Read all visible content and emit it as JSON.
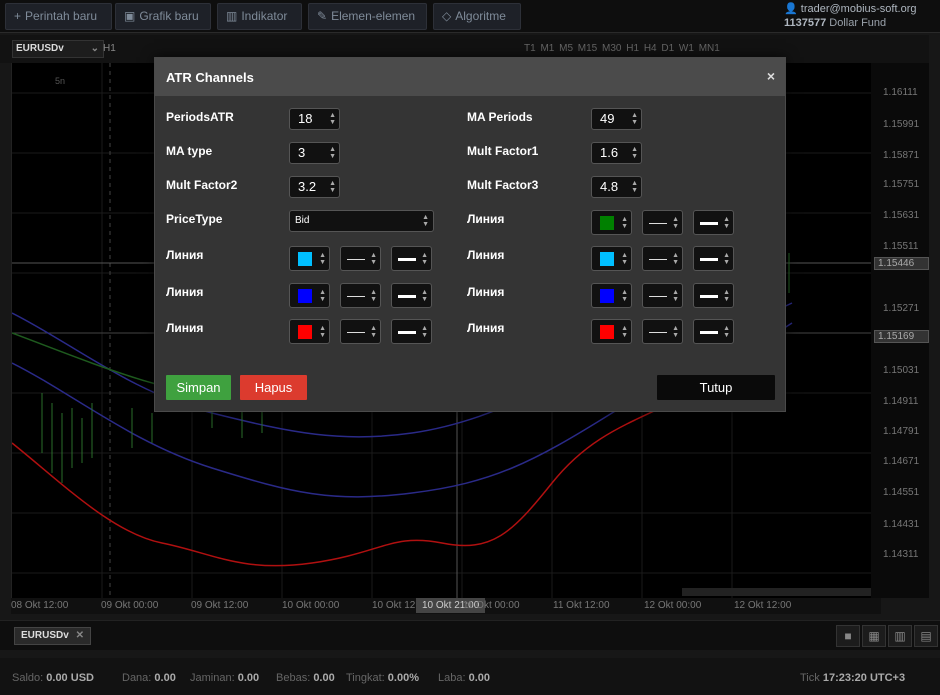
{
  "toolbar": {
    "new_order": "Perintah baru",
    "new_chart": "Grafik baru",
    "indicator": "Indikator",
    "elements": "Elemen-elemen",
    "algorithm": "Algoritme"
  },
  "account": {
    "user": "trader@mobius-soft.org",
    "id": "1137577",
    "fund": "Dollar Fund"
  },
  "chart": {
    "symbol": "EURUSDv",
    "timeframe": "H1",
    "timeframes": "T1 M1 M5 M15 M30 H1 H4 D1 W1 MN1",
    "corner_label": "5n",
    "prices": [
      "1.16111",
      "1.15991",
      "1.15871",
      "1.15751",
      "1.15631",
      "1.15511",
      "1.15446",
      "1.15271",
      "1.15169",
      "1.15031",
      "1.14911",
      "1.14791",
      "1.14671",
      "1.14551",
      "1.14431",
      "1.14311"
    ],
    "times": [
      "08 Okt 12:00",
      "09 Okt 00:00",
      "09 Okt 12:00",
      "10 Okt 00:00",
      "10 Okt 12:00",
      "10 Okt 21:00",
      "11 Okt 00:00",
      "11 Okt 12:00",
      "12 Okt 00:00",
      "12 Okt 12:00"
    ]
  },
  "modal": {
    "title": "ATR Channels",
    "close": "×",
    "left": [
      {
        "label": "PeriodsATR",
        "value": "18"
      },
      {
        "label": "MA type",
        "value": "3"
      },
      {
        "label": "Mult Factor2",
        "value": "3.2"
      },
      {
        "label": "PriceType",
        "value": "Bid"
      }
    ],
    "right": [
      {
        "label": "MA Periods",
        "value": "49"
      },
      {
        "label": "Mult Factor1",
        "value": "1.6"
      },
      {
        "label": "Mult Factor3",
        "value": "4.8"
      },
      {
        "label": "Линия",
        "color": "#008000"
      }
    ],
    "line_label": "Линия",
    "line_colors_left": [
      "#00bfff",
      "#0000ff",
      "#ff0000"
    ],
    "line_colors_right": [
      "#00bfff",
      "#0000ff",
      "#ff0000"
    ],
    "save": "Simpan",
    "delete": "Hapus",
    "close_btn": "Tutup"
  },
  "bottom": {
    "tab": "EURUSDv",
    "tab_close": "✕"
  },
  "status": {
    "saldo_label": "Saldo:",
    "saldo": "0.00",
    "saldo_cur": "USD",
    "dana_label": "Dana:",
    "dana": "0.00",
    "jaminan_label": "Jaminan:",
    "jaminan": "0.00",
    "bebas_label": "Bebas:",
    "bebas": "0.00",
    "tingkat_label": "Tingkat:",
    "tingkat": "0.00%",
    "laba_label": "Laba:",
    "laba": "0.00",
    "tick_label": "Tick",
    "time": "17:23:20",
    "tz": "UTC+3"
  }
}
